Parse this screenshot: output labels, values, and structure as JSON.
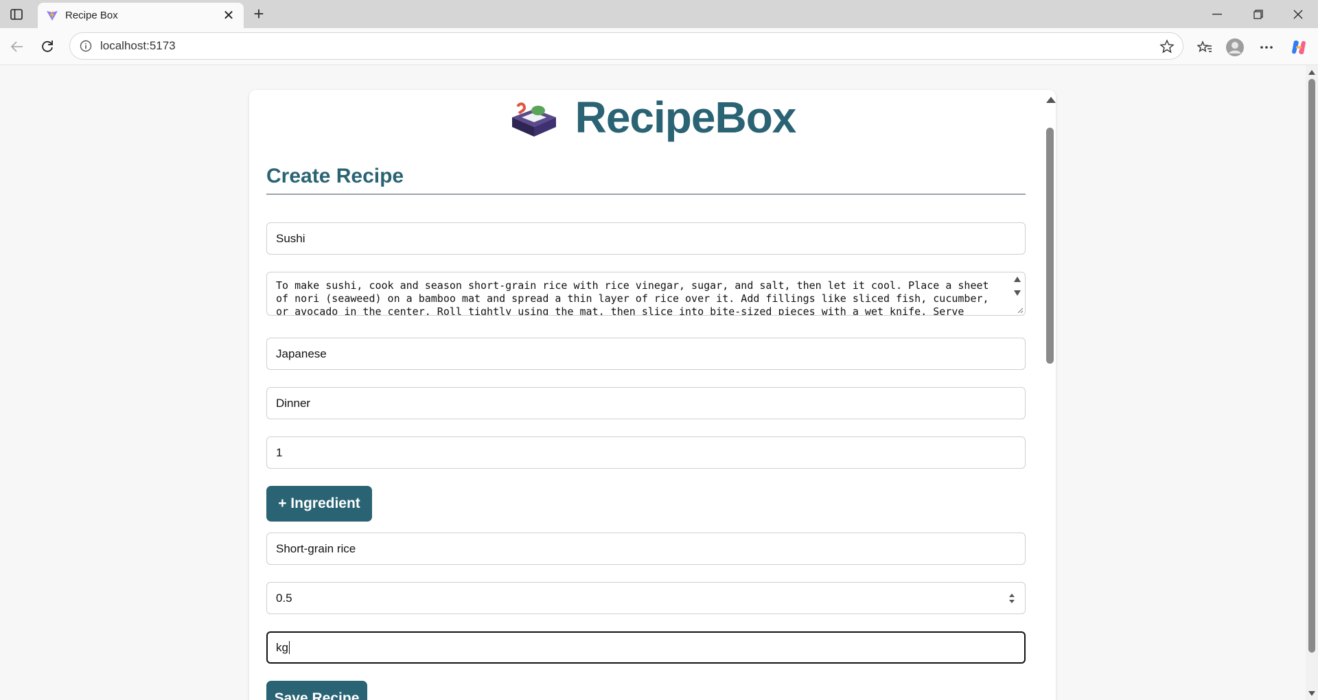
{
  "browser": {
    "tab_title": "Recipe Box",
    "url": "localhost:5173"
  },
  "app": {
    "brand_name": "RecipeBox",
    "brand_color": "#2a6373"
  },
  "form": {
    "heading": "Create Recipe",
    "title_value": "Sushi",
    "instructions_value": "To make sushi, cook and season short-grain rice with rice vinegar, sugar, and salt, then let it cool. Place a sheet of nori (seaweed) on a bamboo mat and spread a thin layer of rice over it. Add fillings like sliced fish, cucumber, or avocado in the center. Roll tightly using the mat, then slice into bite-sized pieces with a wet knife. Serve",
    "cuisine_value": "Japanese",
    "meal_type_value": "Dinner",
    "servings_value": "1",
    "add_ingredient_label": "+ Ingredient",
    "ingredient": {
      "name_value": "Short-grain rice",
      "quantity_value": "0.5",
      "unit_value": "kg"
    },
    "save_label": "Save Recipe"
  }
}
